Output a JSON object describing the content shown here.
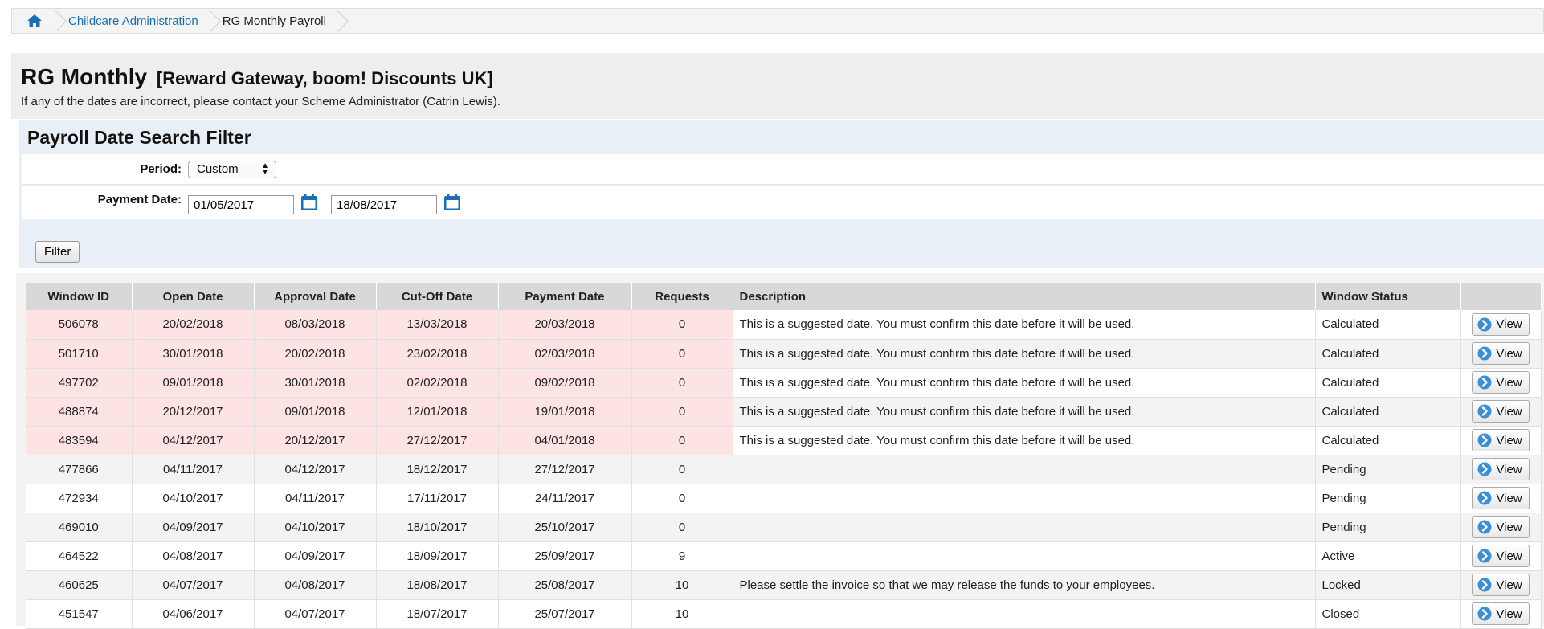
{
  "breadcrumb": {
    "home_icon": "home-icon",
    "items": [
      "Childcare Administration",
      "RG Monthly Payroll"
    ]
  },
  "header": {
    "title": "RG Monthly",
    "subtitle": "[Reward Gateway, boom! Discounts UK]",
    "notice": "If any of the dates are incorrect, please contact your Scheme Administrator (Catrin Lewis)."
  },
  "filter": {
    "title": "Payroll Date Search Filter",
    "period_label": "Period:",
    "period_value": "Custom",
    "payment_date_label": "Payment Date:",
    "date_from": "01/05/2017",
    "date_to": "18/08/2017",
    "calendar_icon": "calendar-icon",
    "button_label": "Filter"
  },
  "table": {
    "headers": [
      "Window ID",
      "Open Date",
      "Approval Date",
      "Cut-Off Date",
      "Payment Date",
      "Requests",
      "Description",
      "Window Status",
      ""
    ],
    "view_label": "View",
    "view_icon": "arrow-right-circle-icon",
    "colors": {
      "suggested_bg": "#fde3e4",
      "header_bg": "#d8d8d8",
      "link": "#1a6fb4"
    },
    "rows": [
      {
        "id": "506078",
        "open": "20/02/2018",
        "approval": "08/03/2018",
        "cutoff": "13/03/2018",
        "payment": "20/03/2018",
        "requests": "0",
        "description": "This is a suggested date. You must confirm this date before it will be used.",
        "status": "Calculated"
      },
      {
        "id": "501710",
        "open": "30/01/2018",
        "approval": "20/02/2018",
        "cutoff": "23/02/2018",
        "payment": "02/03/2018",
        "requests": "0",
        "description": "This is a suggested date. You must confirm this date before it will be used.",
        "status": "Calculated"
      },
      {
        "id": "497702",
        "open": "09/01/2018",
        "approval": "30/01/2018",
        "cutoff": "02/02/2018",
        "payment": "09/02/2018",
        "requests": "0",
        "description": "This is a suggested date. You must confirm this date before it will be used.",
        "status": "Calculated"
      },
      {
        "id": "488874",
        "open": "20/12/2017",
        "approval": "09/01/2018",
        "cutoff": "12/01/2018",
        "payment": "19/01/2018",
        "requests": "0",
        "description": "This is a suggested date. You must confirm this date before it will be used.",
        "status": "Calculated"
      },
      {
        "id": "483594",
        "open": "04/12/2017",
        "approval": "20/12/2017",
        "cutoff": "27/12/2017",
        "payment": "04/01/2018",
        "requests": "0",
        "description": "This is a suggested date. You must confirm this date before it will be used.",
        "status": "Calculated"
      },
      {
        "id": "477866",
        "open": "04/11/2017",
        "approval": "04/12/2017",
        "cutoff": "18/12/2017",
        "payment": "27/12/2017",
        "requests": "0",
        "description": "",
        "status": "Pending"
      },
      {
        "id": "472934",
        "open": "04/10/2017",
        "approval": "04/11/2017",
        "cutoff": "17/11/2017",
        "payment": "24/11/2017",
        "requests": "0",
        "description": "",
        "status": "Pending"
      },
      {
        "id": "469010",
        "open": "04/09/2017",
        "approval": "04/10/2017",
        "cutoff": "18/10/2017",
        "payment": "25/10/2017",
        "requests": "0",
        "description": "",
        "status": "Pending"
      },
      {
        "id": "464522",
        "open": "04/08/2017",
        "approval": "04/09/2017",
        "cutoff": "18/09/2017",
        "payment": "25/09/2017",
        "requests": "9",
        "description": "",
        "status": "Active"
      },
      {
        "id": "460625",
        "open": "04/07/2017",
        "approval": "04/08/2017",
        "cutoff": "18/08/2017",
        "payment": "25/08/2017",
        "requests": "10",
        "description": "Please settle the invoice so that we may release the funds to your employees.",
        "status": "Locked"
      },
      {
        "id": "451547",
        "open": "04/06/2017",
        "approval": "04/07/2017",
        "cutoff": "18/07/2017",
        "payment": "25/07/2017",
        "requests": "10",
        "description": "",
        "status": "Closed"
      }
    ]
  }
}
